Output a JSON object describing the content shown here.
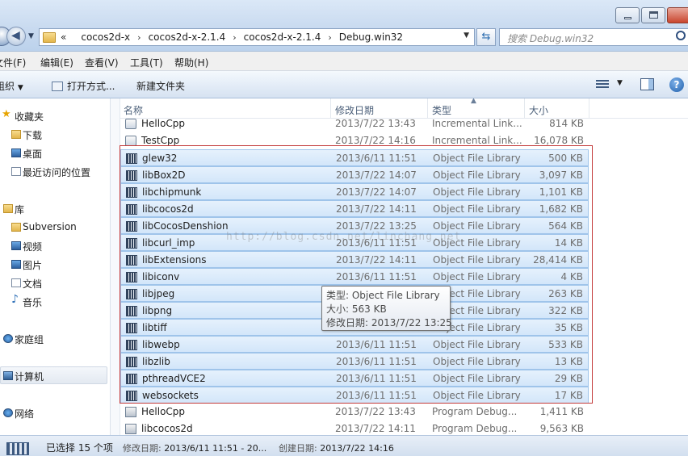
{
  "window": {
    "back_glyph": "◀",
    "forward_glyph": "▶"
  },
  "address": {
    "prefix": "«",
    "crumbs": [
      "cocos2d-x",
      "cocos2d-x-2.1.4",
      "cocos2d-x-2.1.4",
      "Debug.win32"
    ],
    "separator": "›"
  },
  "search": {
    "placeholder": "搜索 Debug.win32"
  },
  "menu": [
    "文件(F)",
    "编辑(E)",
    "查看(V)",
    "工具(T)",
    "帮助(H)"
  ],
  "toolbar": {
    "organize": "组织",
    "open_with": "打开方式...",
    "new_folder": "新建文件夹",
    "help_glyph": "?"
  },
  "nav": {
    "favorites": "收藏夹",
    "downloads": "下载",
    "desktop": "桌面",
    "recent": "最近访问的位置",
    "libraries": "库",
    "subversion": "Subversion",
    "videos": "视频",
    "pictures": "图片",
    "documents": "文档",
    "music": "音乐",
    "homegroup": "家庭组",
    "computer": "计算机",
    "network": "网络"
  },
  "columns": {
    "name": "名称",
    "date": "修改日期",
    "type": "类型",
    "size": "大小"
  },
  "files": [
    {
      "name": "HelloCpp",
      "date": "2013/7/22 13:43",
      "type": "Incremental Link...",
      "size": "814 KB",
      "kind": "ilk",
      "selected": false
    },
    {
      "name": "TestCpp",
      "date": "2013/7/22 14:16",
      "type": "Incremental Link...",
      "size": "16,078 KB",
      "kind": "ilk",
      "selected": false
    },
    {
      "name": "glew32",
      "date": "2013/6/11 11:51",
      "type": "Object File Library",
      "size": "500 KB",
      "kind": "lib",
      "selected": true
    },
    {
      "name": "libBox2D",
      "date": "2013/7/22 14:07",
      "type": "Object File Library",
      "size": "3,097 KB",
      "kind": "lib",
      "selected": true
    },
    {
      "name": "libchipmunk",
      "date": "2013/7/22 14:07",
      "type": "Object File Library",
      "size": "1,101 KB",
      "kind": "lib",
      "selected": true
    },
    {
      "name": "libcocos2d",
      "date": "2013/7/22 14:11",
      "type": "Object File Library",
      "size": "1,682 KB",
      "kind": "lib",
      "selected": true
    },
    {
      "name": "libCocosDenshion",
      "date": "2013/7/22 13:25",
      "type": "Object File Library",
      "size": "564 KB",
      "kind": "lib",
      "selected": true
    },
    {
      "name": "libcurl_imp",
      "date": "2013/6/11 11:51",
      "type": "Object File Library",
      "size": "14 KB",
      "kind": "lib",
      "selected": true
    },
    {
      "name": "libExtensions",
      "date": "2013/7/22 14:11",
      "type": "Object File Library",
      "size": "28,414 KB",
      "kind": "lib",
      "selected": true
    },
    {
      "name": "libiconv",
      "date": "2013/6/11 11:51",
      "type": "Object File Library",
      "size": "4 KB",
      "kind": "lib",
      "selected": true
    },
    {
      "name": "libjpeg",
      "date": "",
      "type": "Object File Library",
      "size": "263 KB",
      "kind": "lib",
      "selected": true
    },
    {
      "name": "libpng",
      "date": "",
      "type": "Object File Library",
      "size": "322 KB",
      "kind": "lib",
      "selected": true
    },
    {
      "name": "libtiff",
      "date": "",
      "type": "Object File Library",
      "size": "35 KB",
      "kind": "lib",
      "selected": true
    },
    {
      "name": "libwebp",
      "date": "2013/6/11 11:51",
      "type": "Object File Library",
      "size": "533 KB",
      "kind": "lib",
      "selected": true
    },
    {
      "name": "libzlib",
      "date": "2013/6/11 11:51",
      "type": "Object File Library",
      "size": "13 KB",
      "kind": "lib",
      "selected": true
    },
    {
      "name": "pthreadVCE2",
      "date": "2013/6/11 11:51",
      "type": "Object File Library",
      "size": "29 KB",
      "kind": "lib",
      "selected": true
    },
    {
      "name": "websockets",
      "date": "2013/6/11 11:51",
      "type": "Object File Library",
      "size": "17 KB",
      "kind": "lib",
      "selected": true
    },
    {
      "name": "HelloCpp",
      "date": "2013/7/22 13:43",
      "type": "Program Debug...",
      "size": "1,411 KB",
      "kind": "pdb",
      "selected": false
    },
    {
      "name": "libcocos2d",
      "date": "2013/7/22 14:11",
      "type": "Program Debug...",
      "size": "9,563 KB",
      "kind": "pdb",
      "selected": false
    }
  ],
  "tooltip": {
    "type": "类型: Object File Library",
    "size": "大小: 563 KB",
    "modified": "修改日期: 2013/7/22 13:25"
  },
  "watermark": "http://blog.csdn.net/linchang.net",
  "status": {
    "selected": "已选择 15 个项",
    "modified_label": "修改日期:",
    "modified_value": "2013/6/11 11:51 - 20...",
    "created_label": "创建日期:",
    "created_value": "2013/7/22 14:16"
  }
}
